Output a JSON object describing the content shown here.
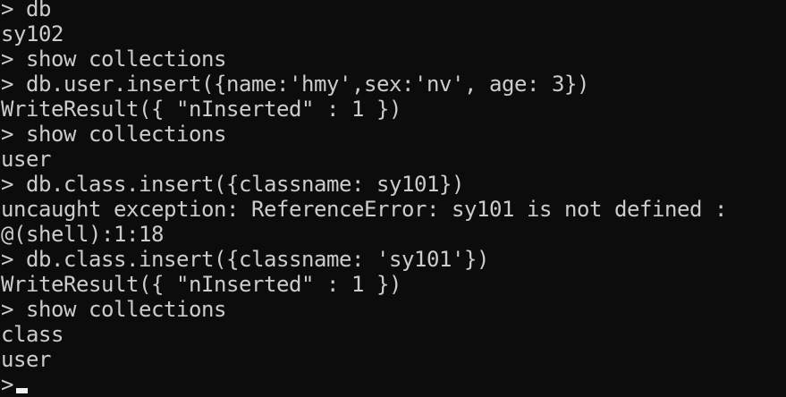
{
  "terminal": {
    "lines": [
      "> db",
      "sy102",
      "> show collections",
      "> db.user.insert({name:'hmy',sex:'nv', age: 3})",
      "WriteResult({ \"nInserted\" : 1 })",
      "> show collections",
      "user",
      "> db.class.insert({classname: sy101})",
      "uncaught exception: ReferenceError: sy101 is not defined :",
      "@(shell):1:18",
      "> db.class.insert({classname: 'sy101'})",
      "WriteResult({ \"nInserted\" : 1 })",
      "> show collections",
      "class",
      "user"
    ],
    "prompt": ">",
    "colors": {
      "background": "#0c0c0c",
      "foreground": "#cccccc",
      "cursor": "#f2f2f2"
    }
  }
}
